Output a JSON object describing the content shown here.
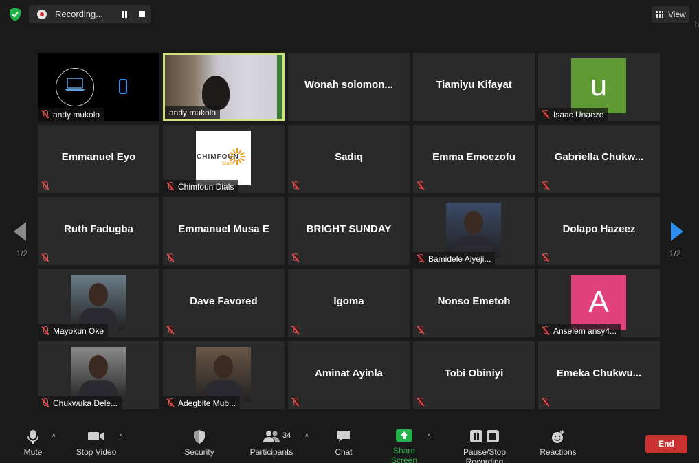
{
  "top_bar": {
    "recording_label": "Recording...",
    "view_label": "View"
  },
  "pager": {
    "left": "1/2",
    "right": "1/2"
  },
  "tiles": [
    {
      "name": "andy mukolo",
      "label": "andy mukolo",
      "muted": true,
      "kind": "share"
    },
    {
      "name": "andy mukolo",
      "label": "andy mukolo",
      "muted": false,
      "kind": "video",
      "active": true
    },
    {
      "name": "Wonah  solomon...",
      "muted": false,
      "kind": "name"
    },
    {
      "name": "Tiamiyu Kifayat",
      "muted": false,
      "kind": "name"
    },
    {
      "name": "Isaac Unaeze",
      "label": "Isaac Unaeze",
      "muted": true,
      "kind": "avatar",
      "letter": "u",
      "color": "#5f9a32"
    },
    {
      "name": "Emmanuel Eyo",
      "muted": true,
      "kind": "name"
    },
    {
      "name": "Chimfoun Dials",
      "label": "Chimfoun Dials",
      "muted": true,
      "kind": "logo",
      "logo_text": "CHIMFOUN",
      "logo_sub": "Dials"
    },
    {
      "name": "Sadiq",
      "muted": true,
      "kind": "name"
    },
    {
      "name": "Emma Emoezofu",
      "muted": true,
      "kind": "name"
    },
    {
      "name": "Gabriella  Chukw...",
      "muted": true,
      "kind": "name"
    },
    {
      "name": "Ruth Fadugba",
      "muted": true,
      "kind": "name"
    },
    {
      "name": "Emmanuel Musa E",
      "muted": true,
      "kind": "name"
    },
    {
      "name": "BRIGHT SUNDAY",
      "muted": true,
      "kind": "name"
    },
    {
      "name": "Bamidele Aiyeji...",
      "label": "Bamidele Aiyeji...",
      "muted": true,
      "kind": "photo",
      "tone": "#3a4a66"
    },
    {
      "name": "Dolapo Hazeez",
      "muted": true,
      "kind": "name"
    },
    {
      "name": "Mayokun Oke",
      "label": "Mayokun Oke",
      "muted": true,
      "kind": "photo",
      "tone": "#6b7d88"
    },
    {
      "name": "Dave Favored",
      "muted": true,
      "kind": "name"
    },
    {
      "name": "Igoma",
      "muted": true,
      "kind": "name"
    },
    {
      "name": "Nonso Emetoh",
      "muted": true,
      "kind": "name"
    },
    {
      "name": "Anselem ansy4...",
      "label": "Anselem ansy4...",
      "muted": true,
      "kind": "avatar",
      "letter": "A",
      "color": "#e2427b"
    },
    {
      "name": "Chukwuka Dele...",
      "label": "Chukwuka Dele...",
      "muted": true,
      "kind": "photo",
      "tone": "#8a8a8a"
    },
    {
      "name": "Adegbite Mub...",
      "label": "Adegbite Mub...",
      "muted": true,
      "kind": "photo",
      "tone": "#6a5646"
    },
    {
      "name": "Aminat Ayinla",
      "muted": true,
      "kind": "name"
    },
    {
      "name": "Tobi Obiniyi",
      "muted": true,
      "kind": "name"
    },
    {
      "name": "Emeka  Chukwu...",
      "muted": true,
      "kind": "name"
    }
  ],
  "toolbar": {
    "mute": "Mute",
    "stop_video": "Stop Video",
    "security": "Security",
    "participants": "Participants",
    "participants_count": "34",
    "chat": "Chat",
    "share_screen": "Share Screen",
    "pause_stop_recording": "Pause/Stop Recording",
    "reactions": "Reactions",
    "end": "End"
  },
  "colors": {
    "active_speaker": "#d4e27a",
    "share_green": "#23b34b",
    "end_red": "#c8312f",
    "muted_red": "#e24b4b",
    "arrow_blue": "#2d8ff0"
  }
}
